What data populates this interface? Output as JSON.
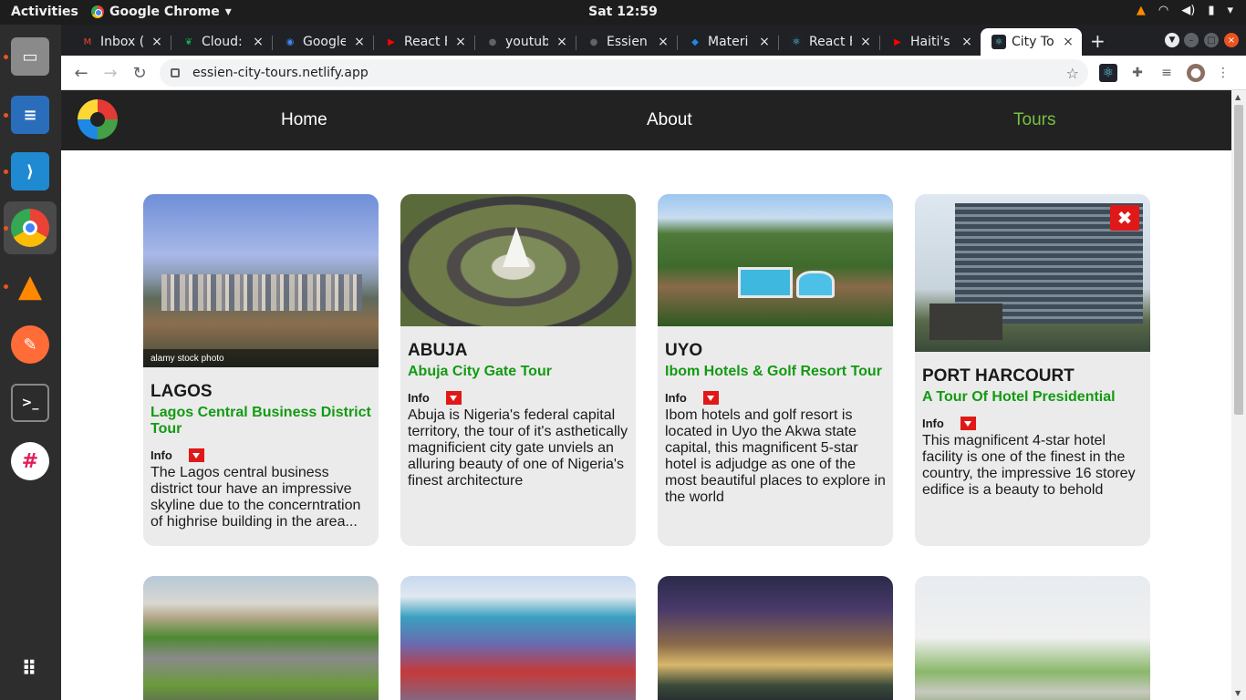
{
  "os": {
    "activities": "Activities",
    "app_name": "Google Chrome",
    "clock": "Sat 12:59"
  },
  "browser": {
    "tabs": [
      {
        "label": "Inbox (",
        "icon": "gmail-icon",
        "color": "#ea4335"
      },
      {
        "label": "Cloud:",
        "icon": "mongodb-icon",
        "color": "#13aa52"
      },
      {
        "label": "Google",
        "icon": "google-maps-icon",
        "color": "#4285f4"
      },
      {
        "label": "React F",
        "icon": "youtube-icon",
        "color": "#ff0000"
      },
      {
        "label": "youtub",
        "icon": "github-icon",
        "color": "#5f6368"
      },
      {
        "label": "Essien",
        "icon": "github-icon",
        "color": "#5f6368"
      },
      {
        "label": "Materi",
        "icon": "material-ui-icon",
        "color": "#1e88e5"
      },
      {
        "label": "React F",
        "icon": "react-icon",
        "color": "#61dafb"
      },
      {
        "label": "Haiti's",
        "icon": "youtube-icon",
        "color": "#ff0000"
      },
      {
        "label": "City To",
        "icon": "react-icon",
        "color": "#61dafb",
        "active": true
      }
    ],
    "url": "essien-city-tours.netlify.app"
  },
  "site": {
    "nav": {
      "home": "Home",
      "about": "About",
      "tours": "Tours"
    },
    "accent_color": "#76c043",
    "tour_title_color": "#139a12",
    "tours": [
      {
        "city": "LAGOS",
        "tour": "Lagos Central Business District Tour",
        "info": "Info",
        "description": "The Lagos central business district tour have an impressive skyline due to the concerntration of highrise building in the area...",
        "watermark": "alamy stock photo"
      },
      {
        "city": "ABUJA",
        "tour": "Abuja City Gate Tour",
        "info": "Info",
        "description": "Abuja is Nigeria's federal capital territory, the tour of it's asthetically magnificient city gate unviels an alluring beauty of one of Nigeria's finest architecture"
      },
      {
        "city": "UYO",
        "tour": "Ibom Hotels & Golf Resort Tour",
        "info": "Info",
        "description": "Ibom hotels and golf resort is located in Uyo the Akwa state capital, this magnificent 5-star hotel is adjudge as one of the most beautiful places to explore in the world"
      },
      {
        "city": "PORT HARCOURT",
        "tour": "A Tour Of Hotel Presidential",
        "info": "Info",
        "description": "This magnificent 4-star hotel facility is one of the finest in the country, the impressive 16 storey edifice is a beauty to behold",
        "close_icon": "✖"
      }
    ]
  }
}
